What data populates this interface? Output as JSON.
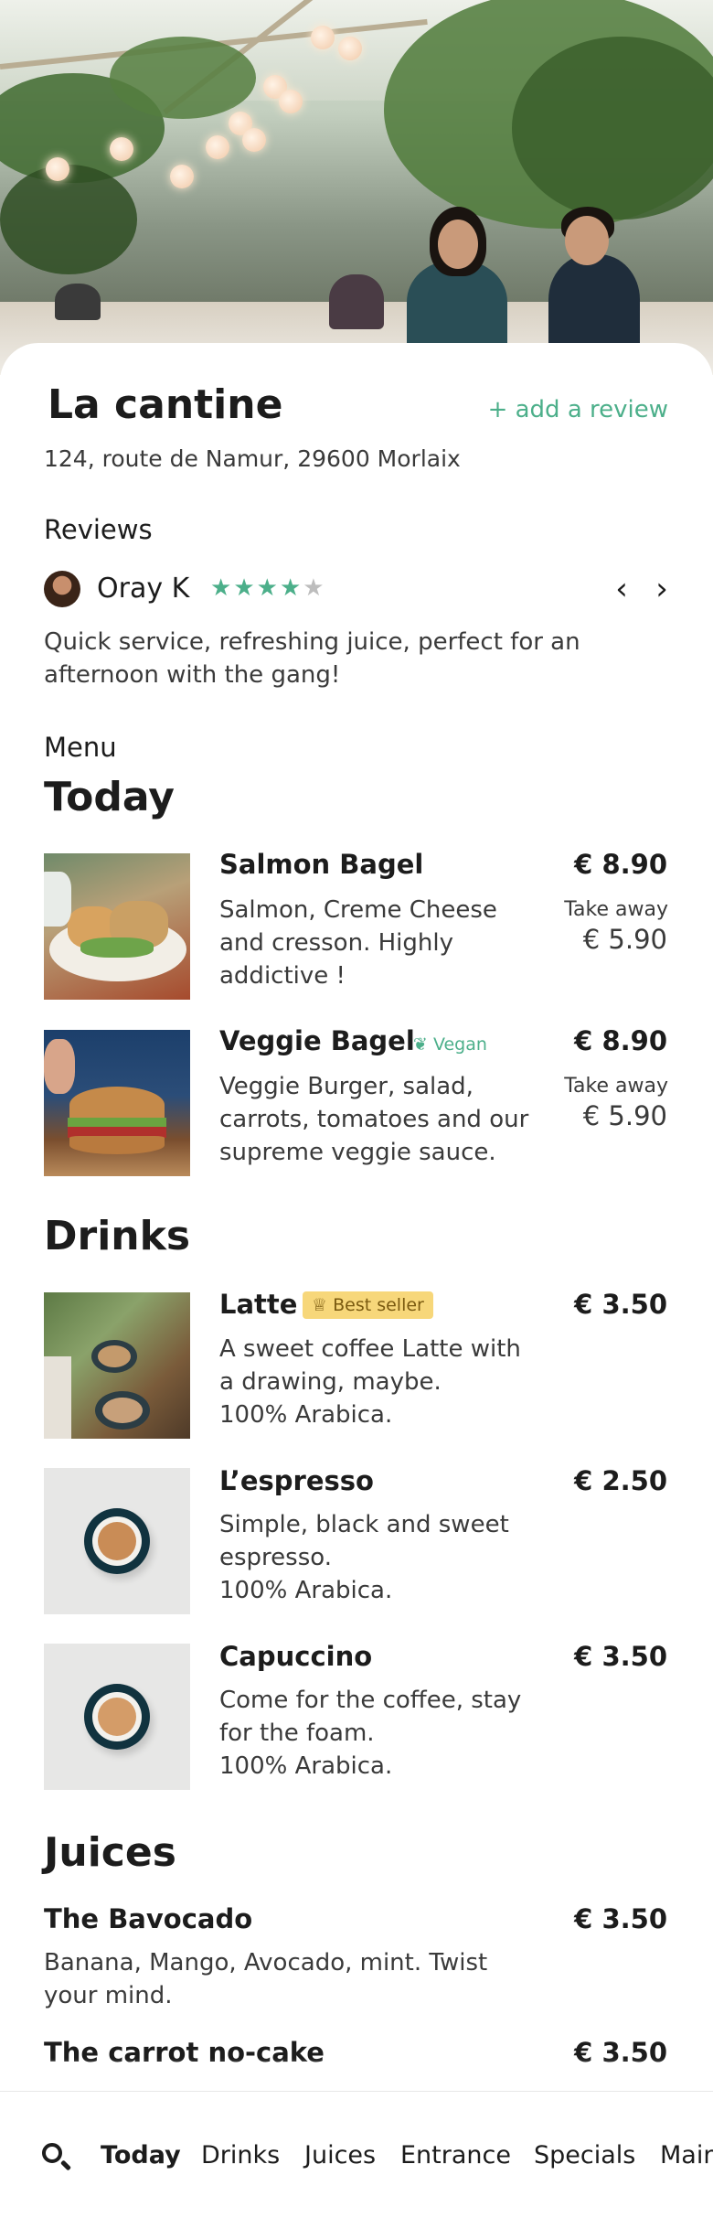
{
  "restaurant": {
    "name": "La cantine",
    "add_review_label": "+ add a review",
    "address": "124, route de Namur, 29600 Morlaix"
  },
  "reviews": {
    "heading": "Reviews",
    "reviewer": "Oray K",
    "rating": 4,
    "rating_max": 5,
    "prev_icon": "chevron-left-icon",
    "next_icon": "chevron-right-icon",
    "text": "Quick service, refreshing juice, perfect for an afternoon with the gang!"
  },
  "menu": {
    "heading": "Menu",
    "today": {
      "heading": "Today",
      "items": [
        {
          "name": "Salmon Bagel",
          "desc_lines": [
            "Salmon, Creme Cheese",
            "and cresson. Highly",
            "addictive !"
          ],
          "price": "€ 8.90",
          "takeaway_label": "Take away",
          "takeaway_price": "€ 5.90"
        },
        {
          "name": "Veggie Bagel",
          "badge": "Vegan",
          "badge_icon": "leaf-icon",
          "desc_lines": [
            "Veggie Burger, salad,",
            "carrots, tomatoes and our",
            "supreme veggie sauce."
          ],
          "price": "€ 8.90",
          "takeaway_label": "Take away",
          "takeaway_price": "€ 5.90"
        }
      ]
    },
    "drinks": {
      "heading": "Drinks",
      "items": [
        {
          "name": "Latte",
          "badge": "Best seller",
          "badge_icon": "medal-icon",
          "desc_lines": [
            "A sweet coffee Latte with",
            "a drawing, maybe.",
            "100% Arabica."
          ],
          "price": "€ 3.50"
        },
        {
          "name": "L’espresso",
          "desc_lines": [
            "Simple, black and sweet",
            "espresso.",
            "100% Arabica."
          ],
          "price": "€ 2.50"
        },
        {
          "name": "Capuccino",
          "desc_lines": [
            "Come for the coffee, stay",
            "for the foam.",
            "100% Arabica."
          ],
          "price": "€ 3.50"
        }
      ]
    },
    "juices": {
      "heading": "Juices",
      "items": [
        {
          "name": "The Bavocado",
          "desc_lines": [
            "Banana, Mango, Avocado, mint. Twist",
            "your mind."
          ],
          "price": "€ 3.50"
        },
        {
          "name": "The carrot no-cake",
          "price": "€ 3.50"
        }
      ]
    }
  },
  "bottom_nav": {
    "search_icon": "search-icon",
    "tabs": [
      "Today",
      "Drinks",
      "Juices",
      "Entrance",
      "Specials",
      "Main"
    ],
    "active_tab": "Today"
  },
  "colors": {
    "accent": "#4caf8a",
    "text": "#1c1c1c",
    "muted_text": "#3a3a3a",
    "best_seller_badge": "#f7d77a",
    "star_empty": "#bdbdbd"
  }
}
